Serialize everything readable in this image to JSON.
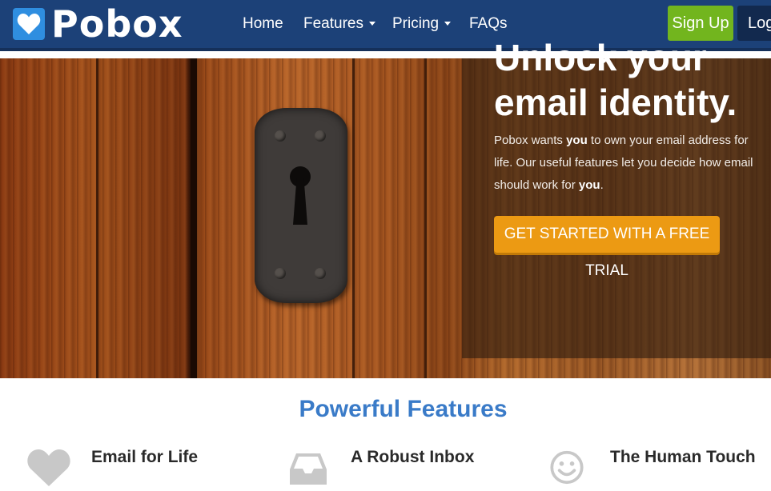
{
  "brand": {
    "name": "Pobox"
  },
  "nav": {
    "home": "Home",
    "features": "Features",
    "pricing": "Pricing",
    "faqs": "FAQs",
    "signup": "Sign Up",
    "login": "Log In"
  },
  "hero": {
    "title_line1": "Unlock your",
    "title_line2": "email identity.",
    "body_part1": "Pobox wants ",
    "body_bold1": "you",
    "body_part2": " to own your email address for life. Our useful features let you decide how email should work for ",
    "body_bold2": "you",
    "body_part3": ".",
    "cta": "GET STARTED WITH A FREE TRIAL"
  },
  "features": {
    "title": "Powerful Features",
    "items": [
      {
        "title": "Email for Life",
        "icon": "heart-icon"
      },
      {
        "title": "A Robust Inbox",
        "icon": "inbox-icon"
      },
      {
        "title": "The Human Touch",
        "icon": "smiley-icon"
      }
    ]
  },
  "colors": {
    "nav_bg": "#1c4178",
    "signup": "#72b51e",
    "cta": "#ec9a13",
    "section_title": "#3a7bc8"
  }
}
